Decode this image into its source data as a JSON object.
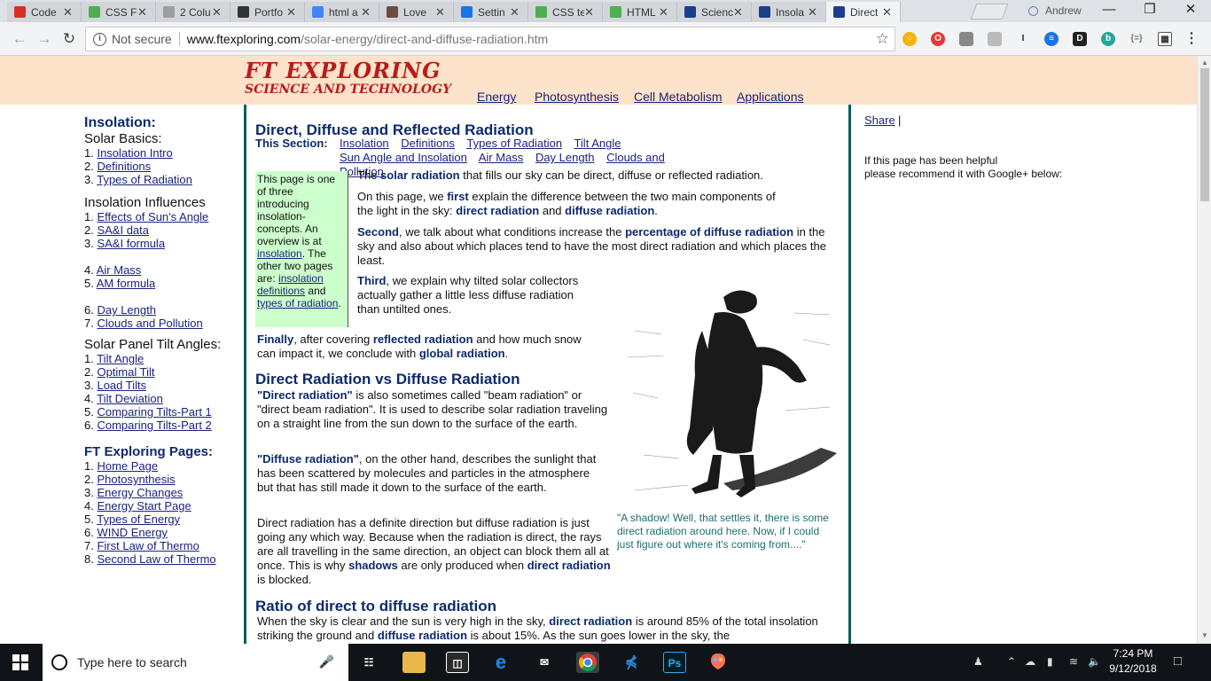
{
  "browser": {
    "tabs": [
      {
        "label": "Code",
        "icon": "code-red-icon",
        "color": "#d93025"
      },
      {
        "label": "CSS Fl",
        "icon": "w3-green-icon",
        "color": "#4caf50"
      },
      {
        "label": "2 Colu",
        "icon": "grid-icon",
        "color": "#9e9e9e"
      },
      {
        "label": "Portfo",
        "icon": "codepen-icon",
        "color": "#333333"
      },
      {
        "label": "html a",
        "icon": "google-icon",
        "color": "#4285f4"
      },
      {
        "label": "Love",
        "icon": "image-icon",
        "color": "#6d4c41"
      },
      {
        "label": "Settin",
        "icon": "settings-icon",
        "color": "#1a73e8"
      },
      {
        "label": "CSS te",
        "icon": "w3-green-icon",
        "color": "#4caf50"
      },
      {
        "label": "HTML",
        "icon": "w3-green-icon",
        "color": "#4caf50"
      },
      {
        "label": "Scienc",
        "icon": "ft-grid-icon",
        "color": "#1a3e8e"
      },
      {
        "label": "Insola",
        "icon": "ft-grid-icon",
        "color": "#1a3e8e"
      },
      {
        "label": "Direct",
        "icon": "ft-grid-icon",
        "color": "#1a3e8e"
      }
    ],
    "profile_name": "Andrew",
    "security": "Not secure",
    "url_host": "www.ftexploring.com",
    "url_path": "/solar-energy/direct-and-diffuse-radiation.htm"
  },
  "site": {
    "logo_line1": "FT EXPLORING",
    "logo_line2": "SCIENCE AND TECHNOLOGY",
    "nav": [
      "Energy",
      "Photosynthesis",
      "Cell Metabolism",
      "Applications"
    ]
  },
  "sidebar": {
    "heading1": "Insolation:",
    "sub1": "Solar Basics:",
    "basics": [
      "1. Insolation Intro",
      "2. Definitions",
      "3. Types of Radiation"
    ],
    "heading2": "Insolation Influences",
    "influences_a": [
      "1. Effects of Sun's Angle",
      "2. SA&I data",
      "3. SA&I formula"
    ],
    "influences_b": [
      "4. Air Mass",
      "5. AM formula"
    ],
    "influences_c": [
      "6. Day Length",
      "7. Clouds and Pollution"
    ],
    "heading3": "Solar Panel Tilt Angles:",
    "tilts": [
      "1. Tilt Angle",
      "2. Optimal Tilt",
      "3. Load Tilts",
      "4. Tilt Deviation",
      "5. Comparing Tilts-Part 1",
      "6. Comparing Tilts-Part 2"
    ],
    "heading4": "FT Exploring Pages:",
    "pages": [
      "1. Home Page",
      "2. Photosynthesis",
      "3. Energy Changes",
      "4. Energy Start Page",
      "5. Types of Energy",
      "6. WIND Energy",
      "7. First Law of Thermo",
      "8. Second Law of Thermo"
    ]
  },
  "main": {
    "title": "Direct, Diffuse and Reflected Radiation",
    "this_section": "This Section:",
    "section_links": [
      "Insolation",
      "Definitions",
      "Types of Radiation",
      "Tilt Angle",
      "Sun Angle and Insolation",
      "Air Mass",
      "Day Length",
      "Clouds and Pollution"
    ],
    "box_text": "This page is one of three introducing insolation-concepts. An overview is at",
    "box_link1": "insolation",
    "box_text2": ". The other two pages are:",
    "box_link2": "insolation definitions",
    "box_text3": "and",
    "box_link3": "types of radiation",
    "box_text4": ".",
    "p1_pre": "The",
    "p1_bold": "solar radiation",
    "p1_post": "that fills our sky can be direct, diffuse or reflected radiation.",
    "p2_pre": "On this page, we",
    "p2_b1": "first",
    "p2_mid": "explain the difference between the two main components of the light in the sky:",
    "p2_b2": "direct radiation",
    "p2_and": "and",
    "p2_b3": "diffuse radiation",
    "p2_end": ".",
    "p3_b1": "Second",
    "p3_mid": ", we talk about what conditions increase the",
    "p3_b2": "percentage of diffuse radiation",
    "p3_end": "in the sky and also about which places tend to have the most direct radiation and which places the least.",
    "p4_b1": "Third",
    "p4_text": ", we explain why tilted solar collectors actually gather a little less diffuse radiation than untilted ones.",
    "p5_b1": "Finally",
    "p5_mid": ", after covering",
    "p5_b2": "reflected radiation",
    "p5_mid2": "and how much snow can impact it, we conclude with",
    "p5_b3": "global radiation",
    "p5_end": ".",
    "h_direct": "Direct Radiation vs Diffuse Radiation",
    "d1_b": "\"Direct radiation\"",
    "d1_text": "is also sometimes called \"beam radiation\" or \"direct beam radiation\". It is used to describe solar radiation traveling on a straight line from the sun down to the surface of the earth.",
    "d2_b": "\"Diffuse radiation\"",
    "d2_text": ", on the other hand, describes the sunlight that has been scattered by molecules and particles in the atmosphere but that has still made it down to the surface of the earth.",
    "d3_text": "Direct radiation has a definite direction but diffuse radiation is just going any which way. Because when the radiation is direct, the rays are all travelling in the same direction, an object can block them all at once. This is why",
    "d3_b1": "shadows",
    "d3_mid": "are only produced when",
    "d3_b2": "direct radiation",
    "d3_end": "is blocked.",
    "caption": "\"A shadow! Well, that settles it, there is some direct radiation around here. Now, if I could just figure out where it's coming from....\"",
    "h_ratio": "Ratio of direct to diffuse radiation",
    "r1_pre": "When the sky is clear and the sun is very high in the sky,",
    "r1_b1": "direct radiation",
    "r1_mid": "is around 85% of the total insolation striking the ground and",
    "r1_b2": "diffuse radiation",
    "r1_end": "is about 15%. As the sun goes lower in the sky, the"
  },
  "right": {
    "share": "Share",
    "share_sep": "|",
    "note1": "If this page has been helpful",
    "note2": "please recommend it with Google+ below:"
  },
  "taskbar": {
    "search_placeholder": "Type here to search",
    "time": "7:24 PM",
    "date": "9/12/2018"
  }
}
